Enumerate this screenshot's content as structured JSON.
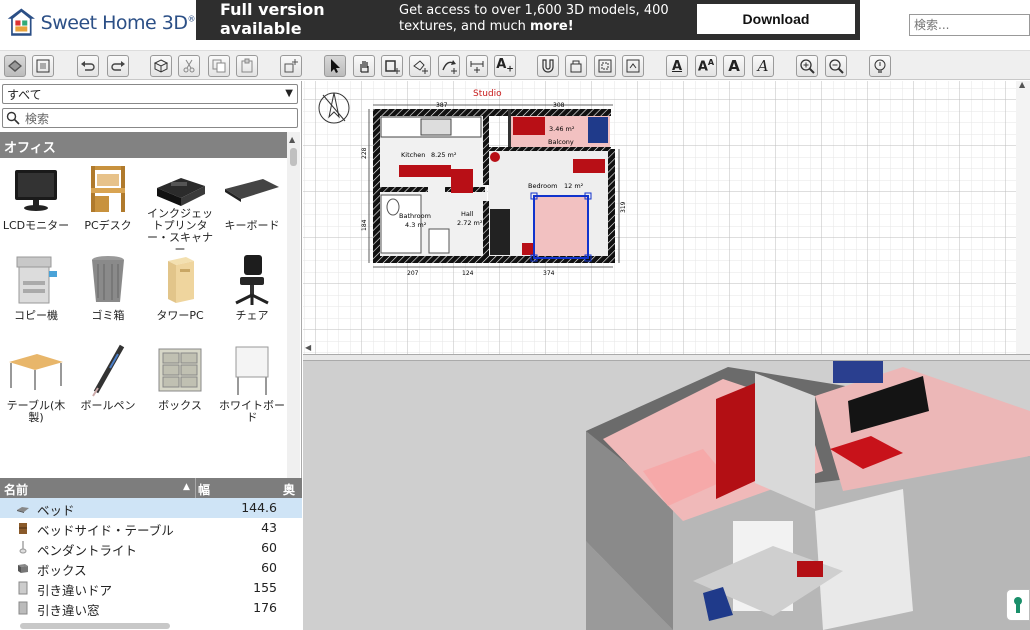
{
  "app": {
    "logo_text": "Sweet Home 3D",
    "logo_mark": "®"
  },
  "ad": {
    "headline_line1": "Full version",
    "headline_line2": "available",
    "pitch_line1": "Get access to over 1,600 3D models, 400",
    "pitch_line2_pre": "textures, and much ",
    "pitch_line2_bold": "more!",
    "download_label": "Download"
  },
  "search": {
    "top_placeholder": "検索...",
    "catalog_placeholder": "検索"
  },
  "catalog": {
    "category_selected": "すべて",
    "group_header": "オフィス",
    "items": [
      {
        "label": "LCDモニター",
        "icon": "lcd-monitor-icon"
      },
      {
        "label": "PCデスク",
        "icon": "pc-desk-icon"
      },
      {
        "label": "インクジェットプリンター・スキャナー",
        "icon": "printer-icon"
      },
      {
        "label": "キーボード",
        "icon": "keyboard-icon"
      },
      {
        "label": "コピー機",
        "icon": "copier-icon"
      },
      {
        "label": "ゴミ箱",
        "icon": "trash-can-icon"
      },
      {
        "label": "タワーPC",
        "icon": "tower-pc-icon"
      },
      {
        "label": "チェア",
        "icon": "chair-icon"
      },
      {
        "label": "テーブル(木製)",
        "icon": "wooden-table-icon"
      },
      {
        "label": "ボールペン",
        "icon": "ballpoint-pen-icon"
      },
      {
        "label": "ボックス",
        "icon": "box-icon"
      },
      {
        "label": "ホワイトボード",
        "icon": "whiteboard-icon"
      }
    ]
  },
  "furniture_table": {
    "col_name": "名前",
    "col_width": "幅",
    "col_depth": "奥行",
    "rows": [
      {
        "name": "ベッド",
        "width": "144.6",
        "selected": true,
        "icon": "bed-icon"
      },
      {
        "name": "ベッドサイド・テーブル",
        "width": "43",
        "selected": false,
        "icon": "nightstand-icon"
      },
      {
        "name": "ペンダントライト",
        "width": "60",
        "selected": false,
        "icon": "pendant-light-icon"
      },
      {
        "name": "ボックス",
        "width": "60",
        "selected": false,
        "icon": "box-icon"
      },
      {
        "name": "引き違いドア",
        "width": "155",
        "selected": false,
        "icon": "sliding-door-icon"
      },
      {
        "name": "引き違い窓",
        "width": "176",
        "selected": false,
        "icon": "sliding-window-icon"
      }
    ]
  },
  "toolbar": {
    "buttons": [
      "plan-view-icon",
      "3d-view-icon",
      "undo-icon",
      "redo-icon",
      "add-furniture-icon",
      "cut-icon",
      "copy-icon",
      "paste-icon",
      "import-furniture-icon",
      "select-mode-icon",
      "pan-mode-icon",
      "create-walls-icon",
      "create-rooms-icon",
      "create-polylines-icon",
      "create-dimensions-icon",
      "add-text-icon",
      "magnet-icon",
      "group-icon",
      "rotate-icon",
      "flip-icon",
      "text-style-icon",
      "text-style-2-icon",
      "bold-text-icon",
      "italic-text-icon",
      "zoom-in-icon",
      "zoom-out-icon",
      "preferences-icon"
    ],
    "text_style_label": "A"
  },
  "plan": {
    "studio_label": "Studio",
    "rooms": [
      {
        "name": "Kitchen",
        "area": "8.25 m²"
      },
      {
        "name": "Bathroom",
        "area": "4.3 m²"
      },
      {
        "name": "Hall",
        "area": "2.72 m²"
      },
      {
        "name": "Bedroom",
        "area": "12 m²"
      },
      {
        "name": "Balcony",
        "area": "3.46 m²"
      }
    ],
    "dimensions": {
      "top_left": "387",
      "top_right": "308",
      "bottom_left": "207",
      "bottom_mid": "124",
      "bottom_right": "374",
      "left_upper": "228",
      "left_lower": "184",
      "right": "319"
    }
  },
  "colors": {
    "wall_pattern": "#111111",
    "floor_pink": "#f2c1c1",
    "furniture_red": "#b80f16",
    "selection_blue": "#1133cc",
    "banner_dark": "#2e2e2e",
    "logo_blue": "#2b4f86"
  }
}
